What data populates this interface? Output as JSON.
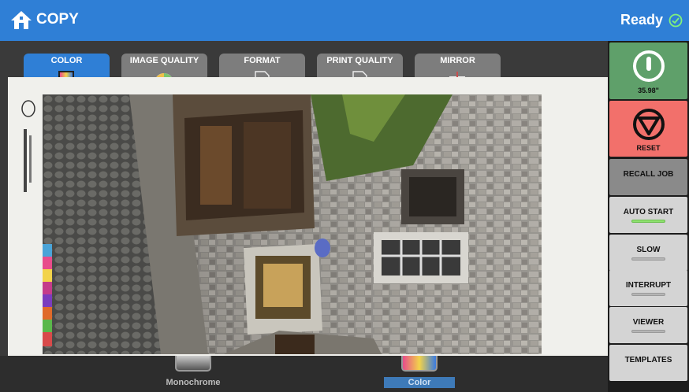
{
  "header": {
    "title": "COPY",
    "status": "Ready",
    "home_icon": "home-icon",
    "status_icon": "ready-check-icon",
    "colors": {
      "bar": "#2f7fd6",
      "text": "#ffffff"
    }
  },
  "tabs": [
    {
      "label": "COLOR",
      "icon": "color-tab-icon",
      "active": true
    },
    {
      "label": "IMAGE QUALITY",
      "icon": "image-quality-icon",
      "active": false
    },
    {
      "label": "FORMAT",
      "icon": "format-icon",
      "active": false
    },
    {
      "label": "PRINT QUALITY",
      "icon": "print-quality-icon",
      "active": false
    },
    {
      "label": "MIRROR",
      "icon": "mirror-icon",
      "active": false
    }
  ],
  "modes": [
    {
      "label": "Monochrome",
      "selected": false
    },
    {
      "label": "Color",
      "selected": true
    }
  ],
  "side": {
    "start_label": "35.98\"",
    "reset_label": "RESET",
    "recall_label": "RECALL JOB",
    "auto_start_label": "AUTO START",
    "slow_label": "SLOW",
    "interrupt_label": "INTERRUPT",
    "viewer_label": "VIEWER",
    "templates_label": "TEMPLATES",
    "auto_start_on": true,
    "colors": {
      "start": "#5fa06a",
      "reset": "#f2706b",
      "indicator_on": "#8ee06f"
    }
  }
}
